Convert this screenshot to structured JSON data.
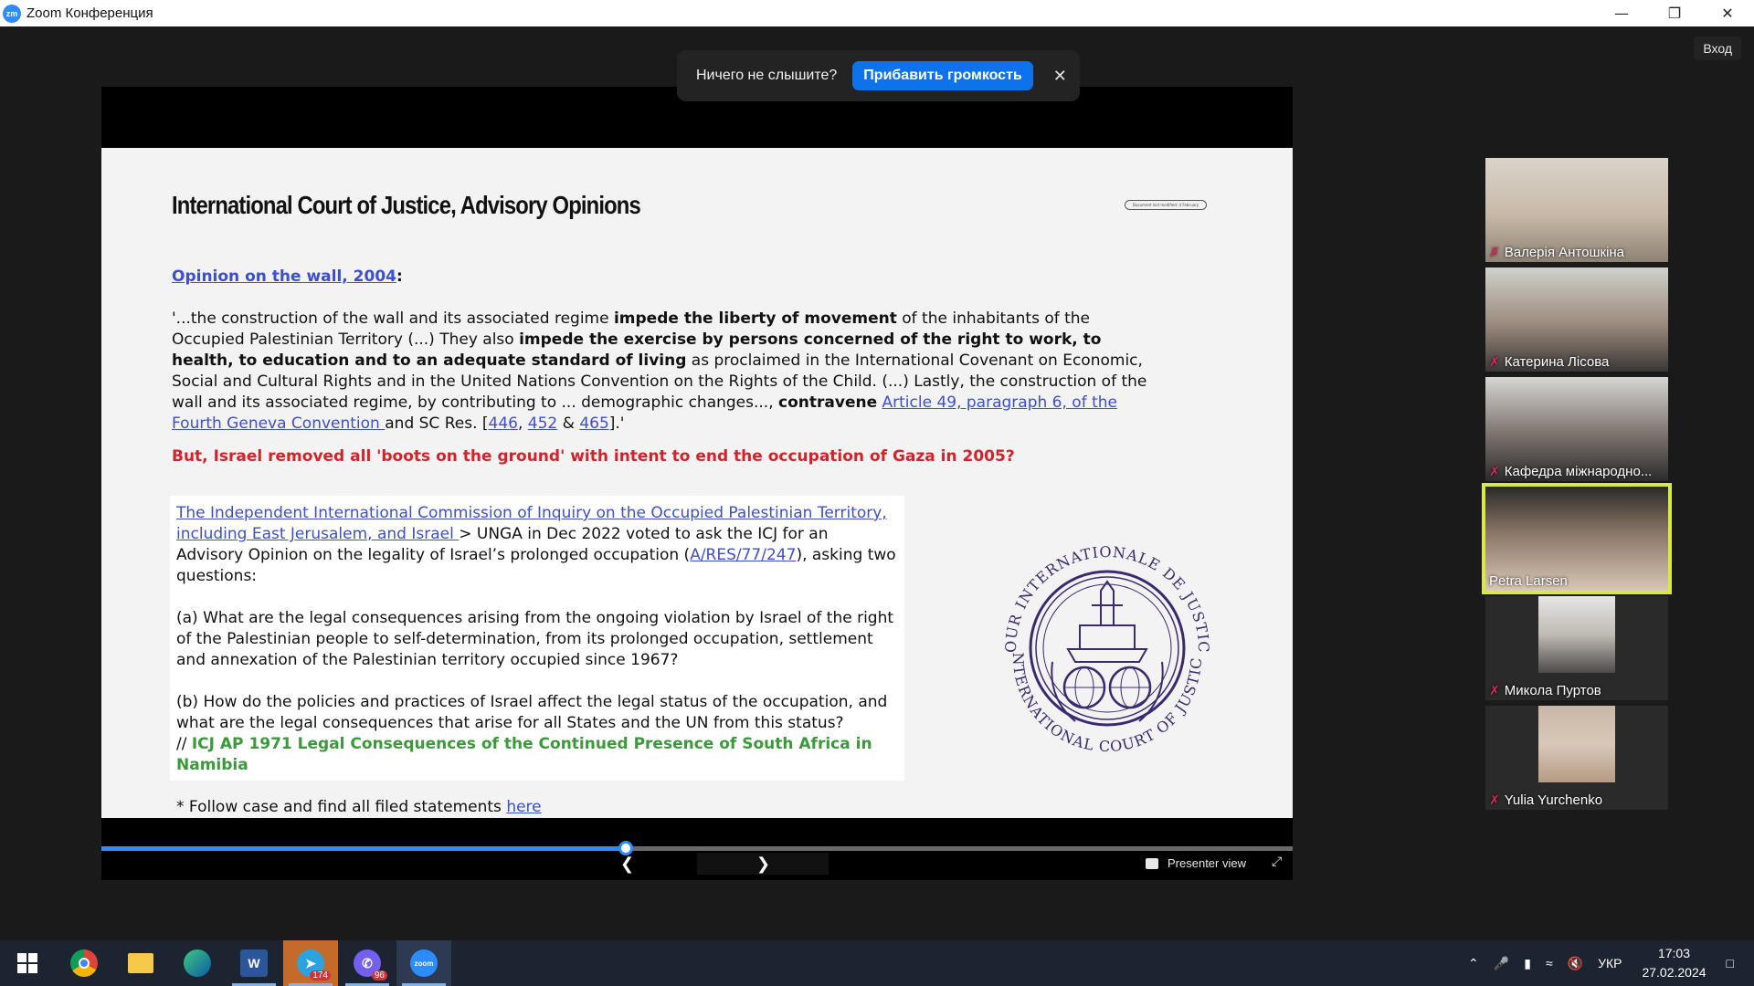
{
  "window": {
    "title": "Zoom Конференция",
    "app_icon_text": "zm",
    "login_label": "Вход"
  },
  "banner": {
    "message": "Ничего не слышите?",
    "button_label": "Прибавить громкость"
  },
  "slide": {
    "title": "International Court of Justice, Advisory Opinions",
    "doc_tag": "Document last modified: 4 February",
    "opinion_link": "Opinion on the wall, 2004",
    "opinion_colon": ":",
    "quote": {
      "t1": "'...the construction of the wall and its associated regime ",
      "b1": "impede the liberty of movement",
      "t2": " of the inhabitants of the Occupied Palestinian Territory (...) They also ",
      "b2": "impede the exercise by persons concerned of the right to work, to health, to education and to an adequate standard of living",
      "t3": " as proclaimed in the International Covenant on Economic, Social and Cultural Rights and in the United Nations Convention on the Rights of the Child. (...) Lastly, the construction of the wall and its associated regime, by contributing to ... demographic changes..., ",
      "b3": "contravene",
      "t4": " ",
      "link1": "Article 49, paragraph 6, of the Fourth Geneva Convention ",
      "t5": "and SC Res. [",
      "link2": "446",
      "t6": ", ",
      "link3": "452",
      "t7": " & ",
      "link4": "465",
      "t8": "].'"
    },
    "red_line": "But, Israel removed all 'boots on the ground' with intent to end the occupation of Gaza in 2005?",
    "box": {
      "commission_link": "The Independent International Commission of Inquiry on the Occupied Palestinian Territory, including East Jerusalem, and Israel ",
      "p1_text": "> UNGA in Dec 2022 voted to ask the ICJ for an Advisory Opinion on the legality of Israel’s prolonged occupation (",
      "res_link": "A/RES/77/247",
      "p1_end": "), asking two questions:",
      "q_a": "(a) What are the legal consequences arising from the ongoing violation by Israel of the right of the Palestinian people to self-determination, from its prolonged occupation, settlement and annexation of the Palestinian territory occupied since 1967?",
      "q_b": "(b) How do the policies and practices of Israel affect the legal status of the occupation, and what are the legal consequences that arise for all States and the UN from this status?",
      "ref_prefix": "// ",
      "ref_green": "ICJ AP 1971 Legal Consequences of the Continued Presence of South Africa in Namibia",
      "follow_text": "* Follow case and find all filed statements ",
      "follow_link": "here"
    },
    "seal": {
      "top_text": "COUR INTERNATIONALE DE JUSTICE",
      "bottom_text": "INTERNATIONAL COURT OF JUSTICE",
      "color": "#3b2a6e"
    }
  },
  "controls": {
    "progress": 0.44,
    "presenter_label": "Presenter view"
  },
  "participants": [
    {
      "name": "Валерія Антошкіна",
      "muted": true,
      "active": false
    },
    {
      "name": "Катерина Лісова",
      "muted": true,
      "active": false
    },
    {
      "name": "Кафедра міжнародно...",
      "muted": true,
      "active": false
    },
    {
      "name": "Petra Larsen",
      "muted": false,
      "active": true
    },
    {
      "name": "Микола Пуртов",
      "muted": true,
      "active": false
    },
    {
      "name": "Yulia Yurchenko",
      "muted": true,
      "active": false
    }
  ],
  "taskbar": {
    "telegram_badge": "174",
    "viber_badge": "96",
    "zoom_label": "zoom",
    "word_label": "W",
    "lang": "УКР",
    "time": "17:03",
    "date": "27.02.2024"
  }
}
